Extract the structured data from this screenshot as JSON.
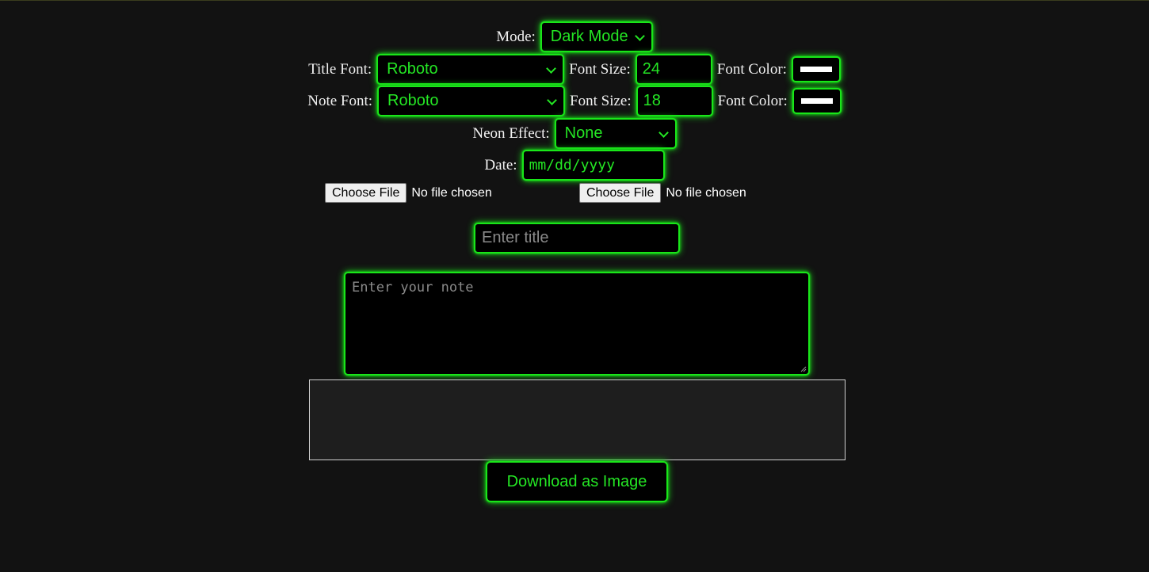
{
  "mode": {
    "label": "Mode:",
    "value": "Dark Mode"
  },
  "title_font": {
    "label": "Title Font:",
    "value": "Roboto",
    "size_label": "Font Size:",
    "size_value": "24",
    "color_label": "Font Color:",
    "color_value": "#ffffff"
  },
  "note_font": {
    "label": "Note Font:",
    "value": "Roboto",
    "size_label": "Font Size:",
    "size_value": "18",
    "color_label": "Font Color:",
    "color_value": "#ffffff"
  },
  "neon_effect": {
    "label": "Neon Effect:",
    "value": "None"
  },
  "date": {
    "label": "Date:",
    "placeholder": "mm/dd/yyyy"
  },
  "file_inputs": [
    {
      "button": "Choose File",
      "status": "No file chosen"
    },
    {
      "button": "Choose File",
      "status": "No file chosen"
    }
  ],
  "title_input": {
    "placeholder": "Enter title"
  },
  "note_input": {
    "placeholder": "Enter your note"
  },
  "download_button": {
    "label": "Download as Image"
  },
  "colors": {
    "accent": "#19e619",
    "background": "#121212",
    "preview_bg": "#1e1e1e"
  }
}
